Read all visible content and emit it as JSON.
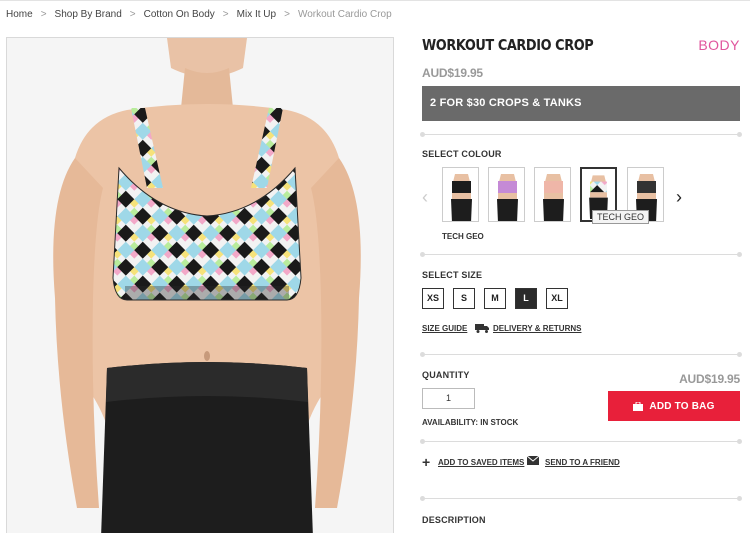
{
  "breadcrumb": {
    "items": [
      "Home",
      "Shop By Brand",
      "Cotton On Body",
      "Mix It Up",
      "Workout Cardio Crop"
    ],
    "separator": ">"
  },
  "product": {
    "title": "WORKOUT CARDIO CROP",
    "brand_logo": "BODY",
    "price": "AUD$19.95",
    "promo": "2 FOR $30 CROPS & TANKS"
  },
  "colour": {
    "label": "SELECT COLOUR",
    "selected_name": "TECH GEO",
    "tooltip": "TECH GEO",
    "swatches": [
      {
        "name": "black",
        "top_color": "#1c1c1c"
      },
      {
        "name": "lilac",
        "top_color": "#c58ad6"
      },
      {
        "name": "peach",
        "top_color": "#efb6a8"
      },
      {
        "name": "tech geo",
        "top_color": "#a9a9a9"
      },
      {
        "name": "charcoal",
        "top_color": "#333333"
      }
    ],
    "prev_arrow": "‹",
    "next_arrow": "›"
  },
  "size": {
    "label": "SELECT SIZE",
    "options": [
      "XS",
      "S",
      "M",
      "L",
      "XL"
    ],
    "selected": "L"
  },
  "links": {
    "size_guide": "SIZE GUIDE",
    "delivery": "DELIVERY & RETURNS",
    "saved_items": "ADD TO SAVED ITEMS",
    "send_friend": "SEND TO A FRIEND"
  },
  "quantity": {
    "label": "QUANTITY",
    "value": "1"
  },
  "purchase": {
    "price": "AUD$19.95",
    "add_to_bag": "ADD TO BAG",
    "availability": "AVAILABILITY:  IN STOCK"
  },
  "description": {
    "label": "DESCRIPTION"
  },
  "colors": {
    "promo_bg": "#6a6a6a",
    "cta": "#e8203a",
    "brand": "#e0569d"
  }
}
